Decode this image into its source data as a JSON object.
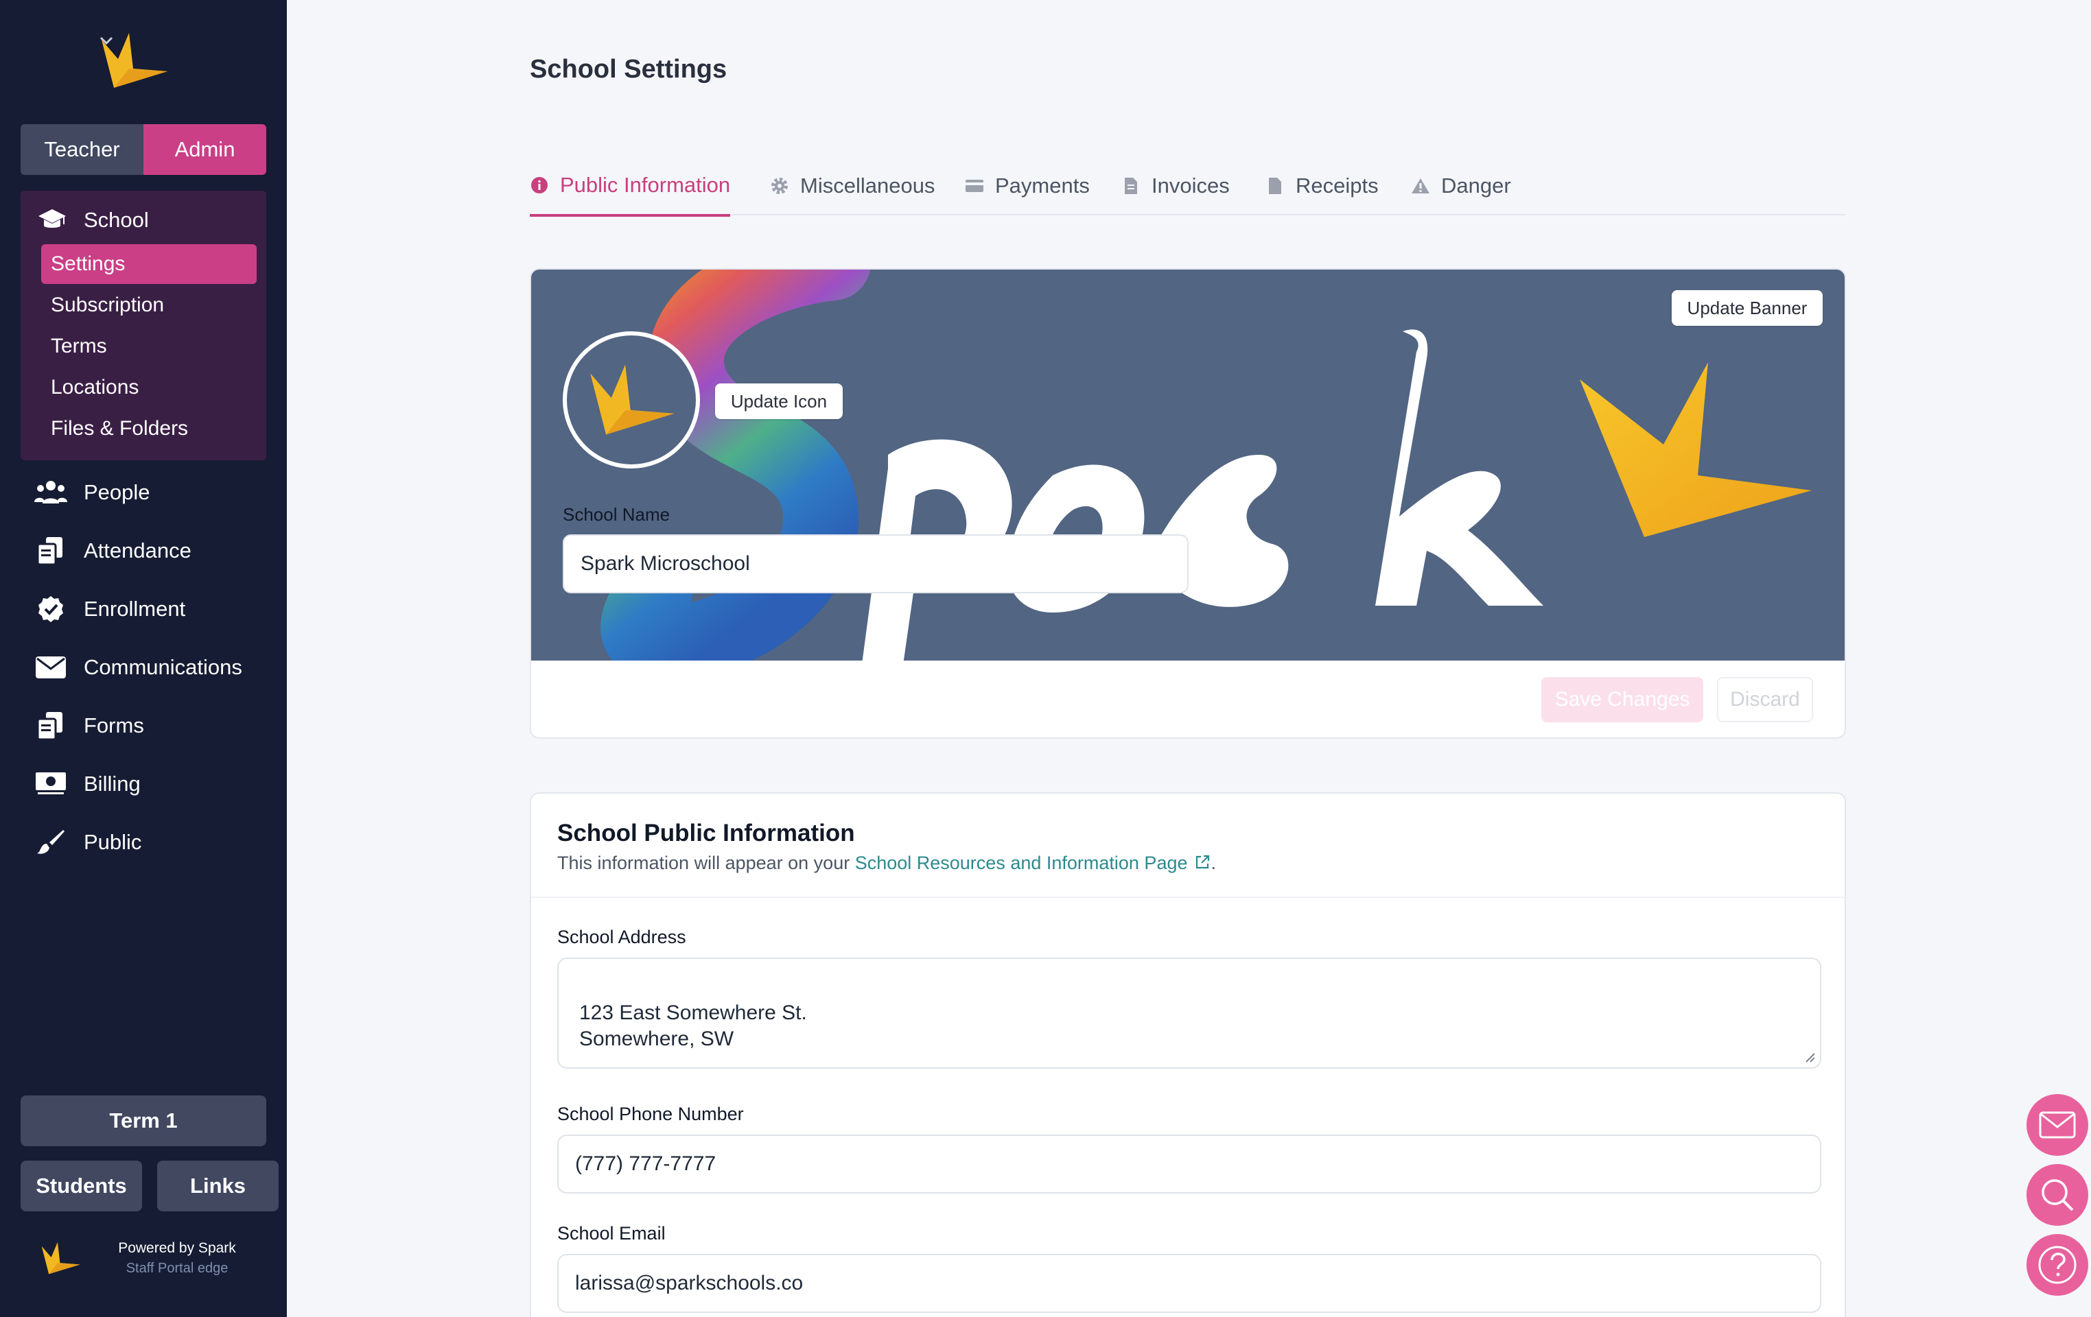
{
  "sidebar": {
    "role_toggle": {
      "teacher": "Teacher",
      "admin": "Admin",
      "active": "Admin"
    },
    "school_group": {
      "label": "School",
      "items": [
        {
          "label": "Settings",
          "active": true
        },
        {
          "label": "Subscription",
          "active": false
        },
        {
          "label": "Terms",
          "active": false
        },
        {
          "label": "Locations",
          "active": false
        },
        {
          "label": "Files & Folders",
          "active": false
        }
      ]
    },
    "nav": [
      {
        "label": "People",
        "icon": "people-icon"
      },
      {
        "label": "Attendance",
        "icon": "attendance-icon"
      },
      {
        "label": "Enrollment",
        "icon": "enrollment-icon"
      },
      {
        "label": "Communications",
        "icon": "envelope-icon"
      },
      {
        "label": "Forms",
        "icon": "forms-icon"
      },
      {
        "label": "Billing",
        "icon": "billing-icon"
      },
      {
        "label": "Public",
        "icon": "brush-icon"
      }
    ],
    "term": "Term 1",
    "students": "Students",
    "links": "Links",
    "powered_by": "Powered by Spark",
    "portal": "Staff Portal edge"
  },
  "page": {
    "title": "School Settings"
  },
  "tabs": [
    {
      "label": "Public Information",
      "icon": "info-icon",
      "active": true
    },
    {
      "label": "Miscellaneous",
      "icon": "gear-icon",
      "active": false
    },
    {
      "label": "Payments",
      "icon": "credit-card-icon",
      "active": false
    },
    {
      "label": "Invoices",
      "icon": "invoice-icon",
      "active": false
    },
    {
      "label": "Receipts",
      "icon": "receipt-icon",
      "active": false
    },
    {
      "label": "Danger",
      "icon": "warning-icon",
      "active": false
    }
  ],
  "banner": {
    "update_banner": "Update Banner",
    "update_icon": "Update Icon",
    "school_name_label": "School Name",
    "school_name_value": "Spark Microschool",
    "save": "Save Changes",
    "discard": "Discard"
  },
  "public_info": {
    "title": "School Public Information",
    "desc_prefix": "This information will appear on your ",
    "desc_link": "School Resources and Information Page",
    "desc_suffix": ".",
    "address_label": "School Address",
    "address_value": "123 East Somewhere St.\nSomewhere, SW",
    "phone_label": "School Phone Number",
    "phone_value": "(777) 777-7777",
    "email_label": "School Email",
    "email_value": "larissa@sparkschools.co"
  },
  "colors": {
    "sidebar_bg": "#161c33",
    "accent": "#cb3f86",
    "banner_bg": "#526582",
    "link": "#2b8a8f",
    "fab": "#e8619c"
  },
  "floating_actions": [
    "mail-icon",
    "search-icon",
    "help-icon"
  ]
}
